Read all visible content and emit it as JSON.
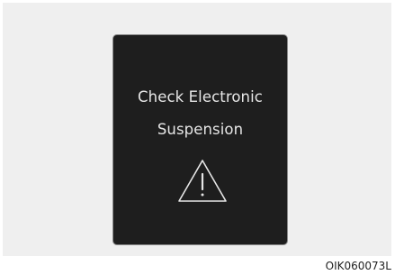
{
  "message": {
    "line1": "Check Electronic",
    "line2": "Suspension"
  },
  "warning_icon": "warning-triangle-icon",
  "figure_code": "OIK060073L",
  "colors": {
    "display_background": "#1e1e1e",
    "text": "#e6e6e6",
    "surround": "#efefef"
  }
}
